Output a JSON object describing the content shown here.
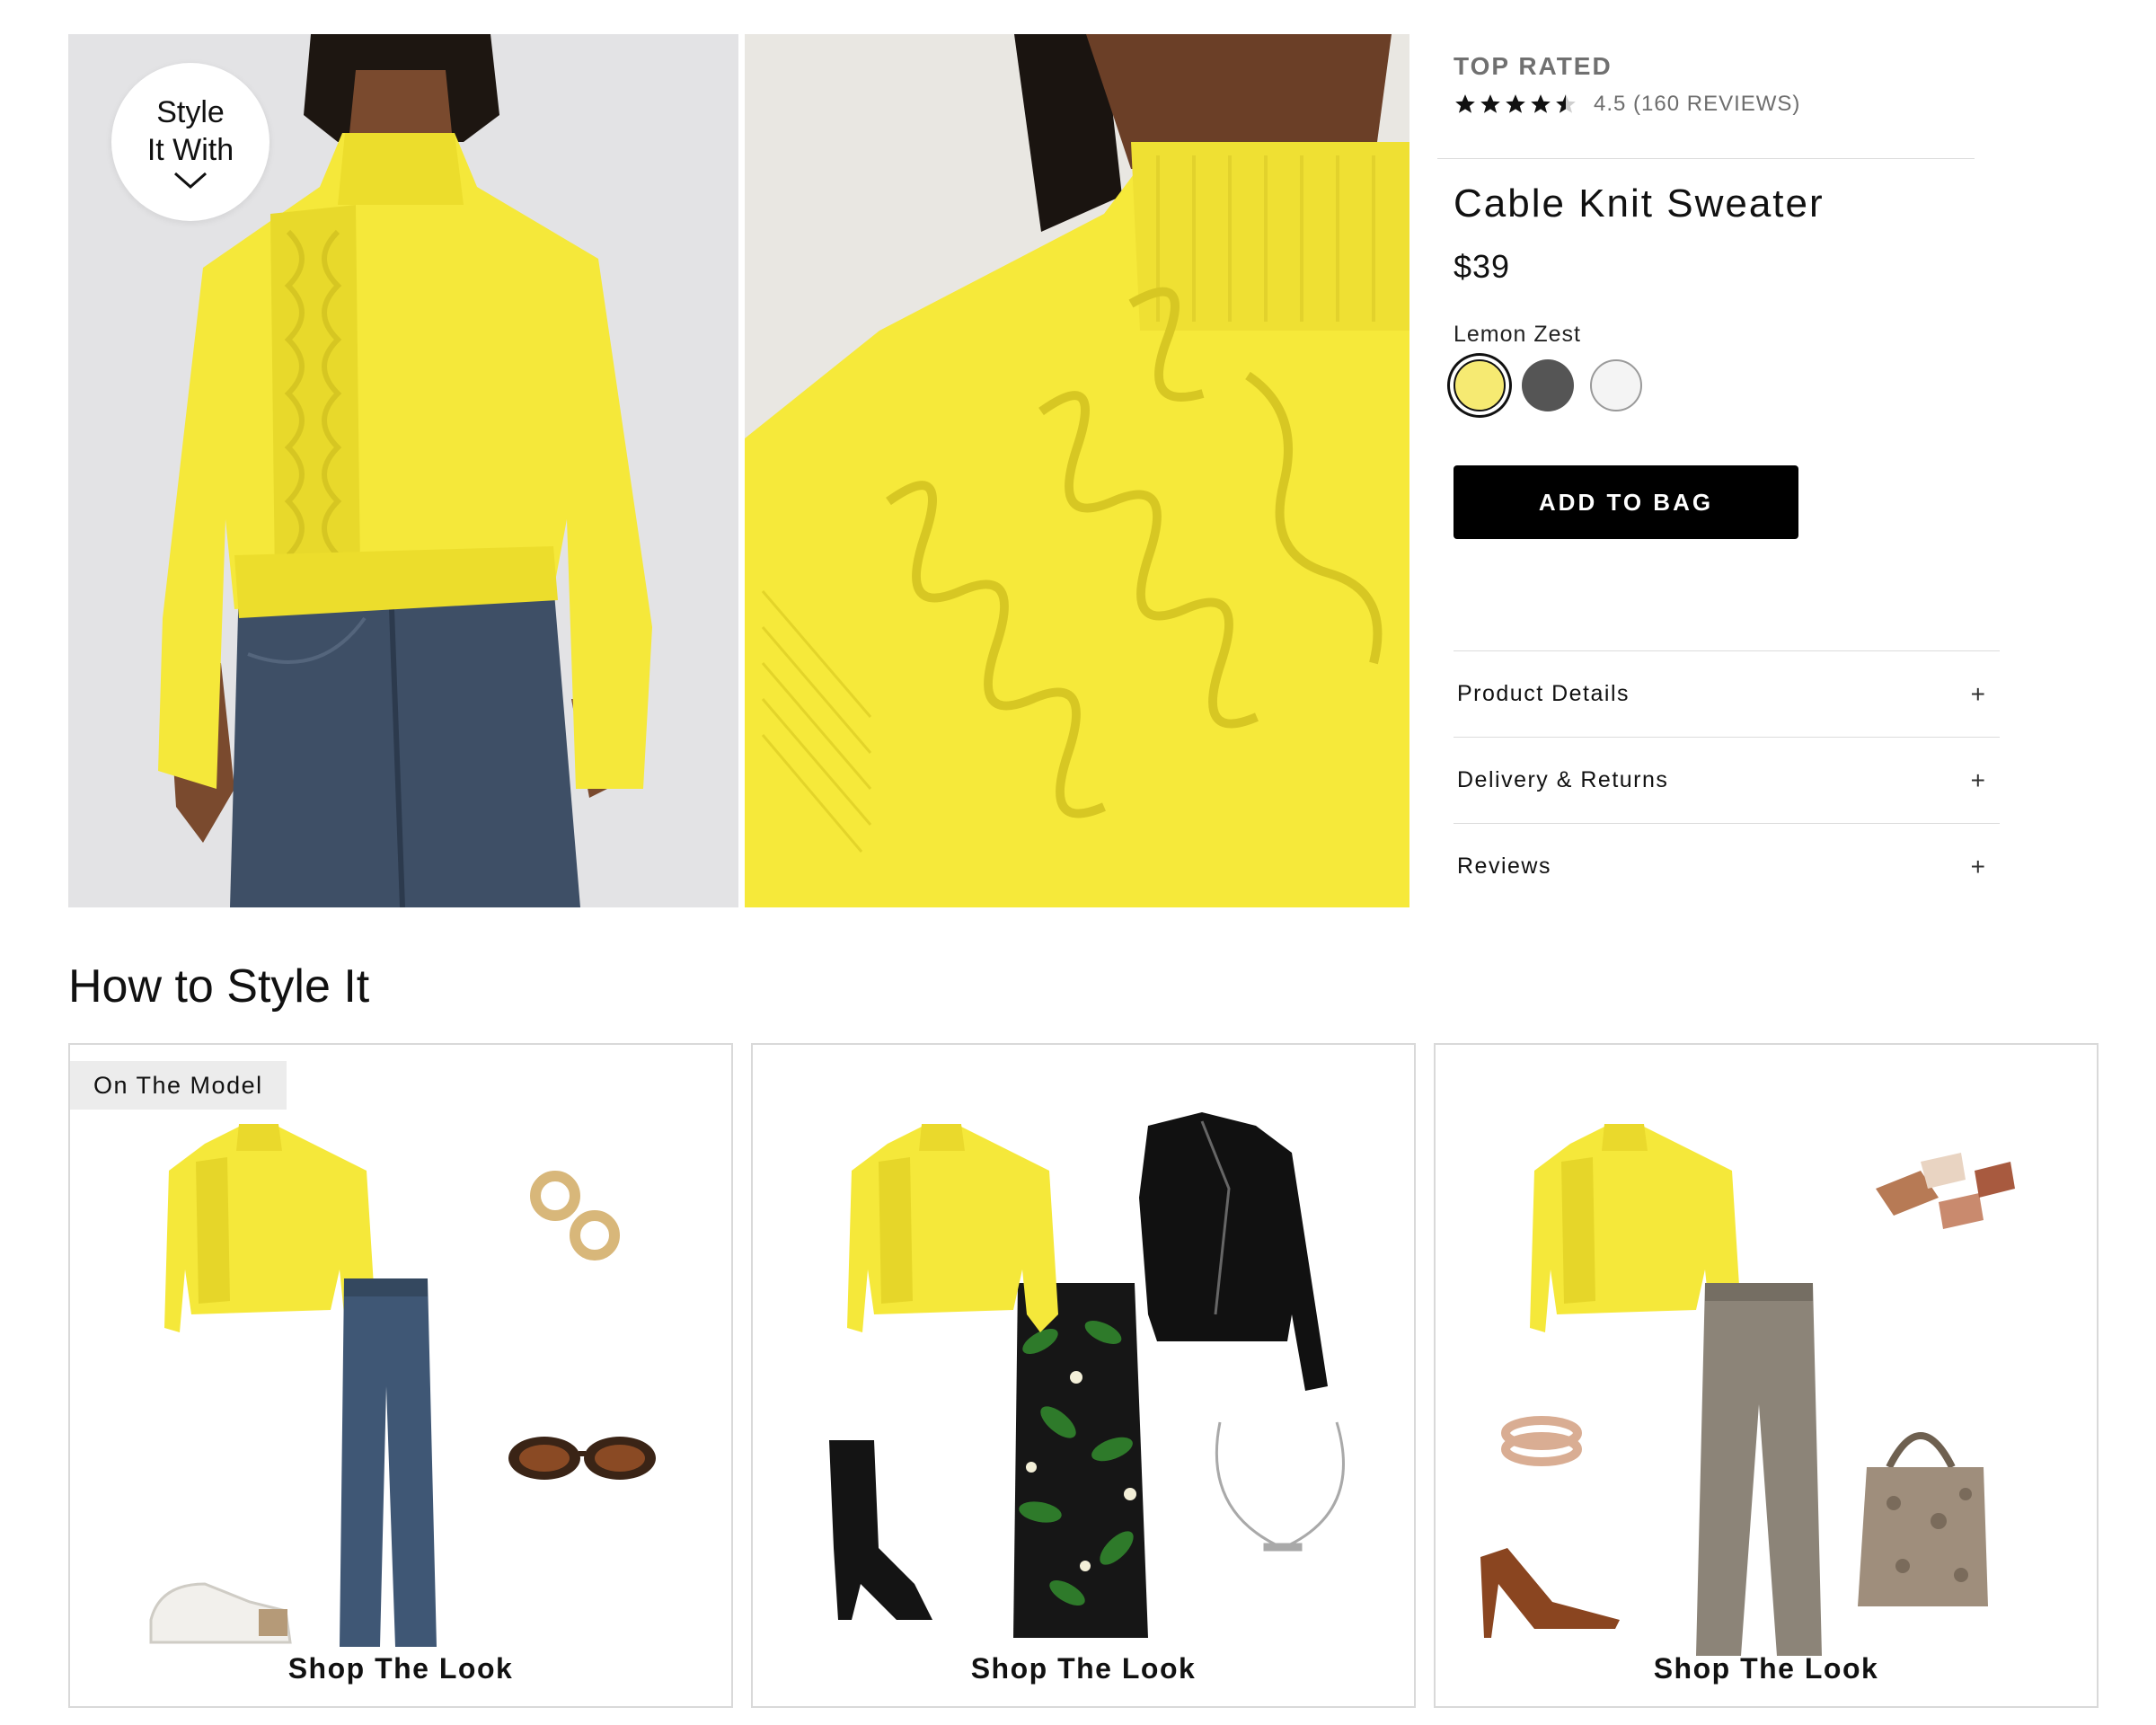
{
  "gallery": {
    "style_badge": {
      "line1": "Style",
      "line2": "It With",
      "icon": "chevron-down-icon"
    },
    "images": [
      "model-front-photo",
      "sweater-closeup-photo"
    ]
  },
  "product": {
    "badge": "TOP RATED",
    "rating": {
      "value": 4.5,
      "max": 5,
      "text": "4.5 (160 REVIEWS)"
    },
    "title": "Cable Knit Sweater",
    "price": "$39",
    "color_name": "Lemon Zest",
    "swatches": [
      {
        "name": "Lemon Zest",
        "color": "#f6ea72",
        "selected": true
      },
      {
        "name": "Charcoal",
        "color": "#555555",
        "selected": false
      },
      {
        "name": "White",
        "color": "#f4f4f4",
        "selected": false
      }
    ],
    "add_to_bag": "ADD TO BAG",
    "accordion": [
      {
        "label": "Product Details",
        "icon": "plus-icon"
      },
      {
        "label": "Delivery & Returns",
        "icon": "plus-icon"
      },
      {
        "label": "Reviews",
        "icon": "plus-icon"
      }
    ]
  },
  "styling": {
    "title": "How to Style It",
    "looks": [
      {
        "tag": "On The Model",
        "cta": "Shop The Look",
        "items": [
          "sweater",
          "jeans",
          "hoop-earrings",
          "sunglasses",
          "sneakers"
        ]
      },
      {
        "tag": "",
        "cta": "Shop The Look",
        "items": [
          "sweater",
          "leather-jacket",
          "floral-skirt",
          "slouch-boot",
          "necklace"
        ]
      },
      {
        "tag": "",
        "cta": "Shop The Look",
        "items": [
          "sweater",
          "claw-clips",
          "bangle",
          "trousers",
          "slingback-pump",
          "snakeskin-tote"
        ]
      }
    ]
  },
  "colors": {
    "sweater_yellow": "#f5e83a",
    "button_black": "#000000",
    "divider": "#dcdcdc"
  }
}
